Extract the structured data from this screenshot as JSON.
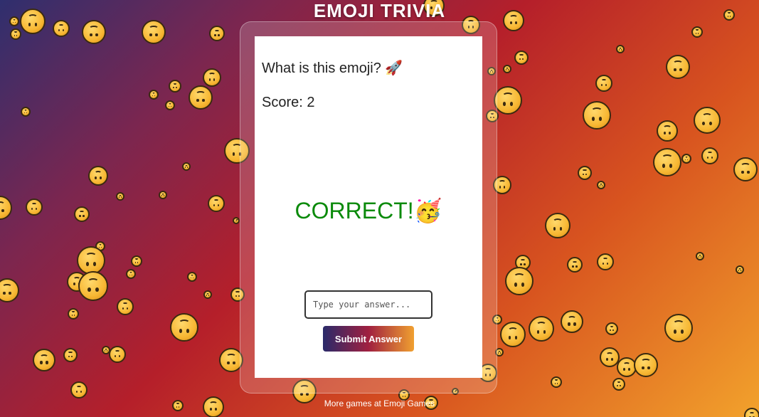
{
  "header": {
    "title": "EMOJI TRIVIA"
  },
  "quiz": {
    "question": "What is this emoji? 🚀",
    "score_label": "Score: 2",
    "result_text": "CORRECT!🥳",
    "answer_input": {
      "placeholder": "Type your answer...",
      "value": ""
    },
    "submit_label": "Submit Answer"
  },
  "footer": {
    "text": "More games at Emoji Games"
  },
  "colors": {
    "correct": "#0a8a0a",
    "background_start": "#2f2f6e",
    "background_end": "#f2a22c"
  },
  "background": {
    "icon": "upside-down-face-icon"
  }
}
